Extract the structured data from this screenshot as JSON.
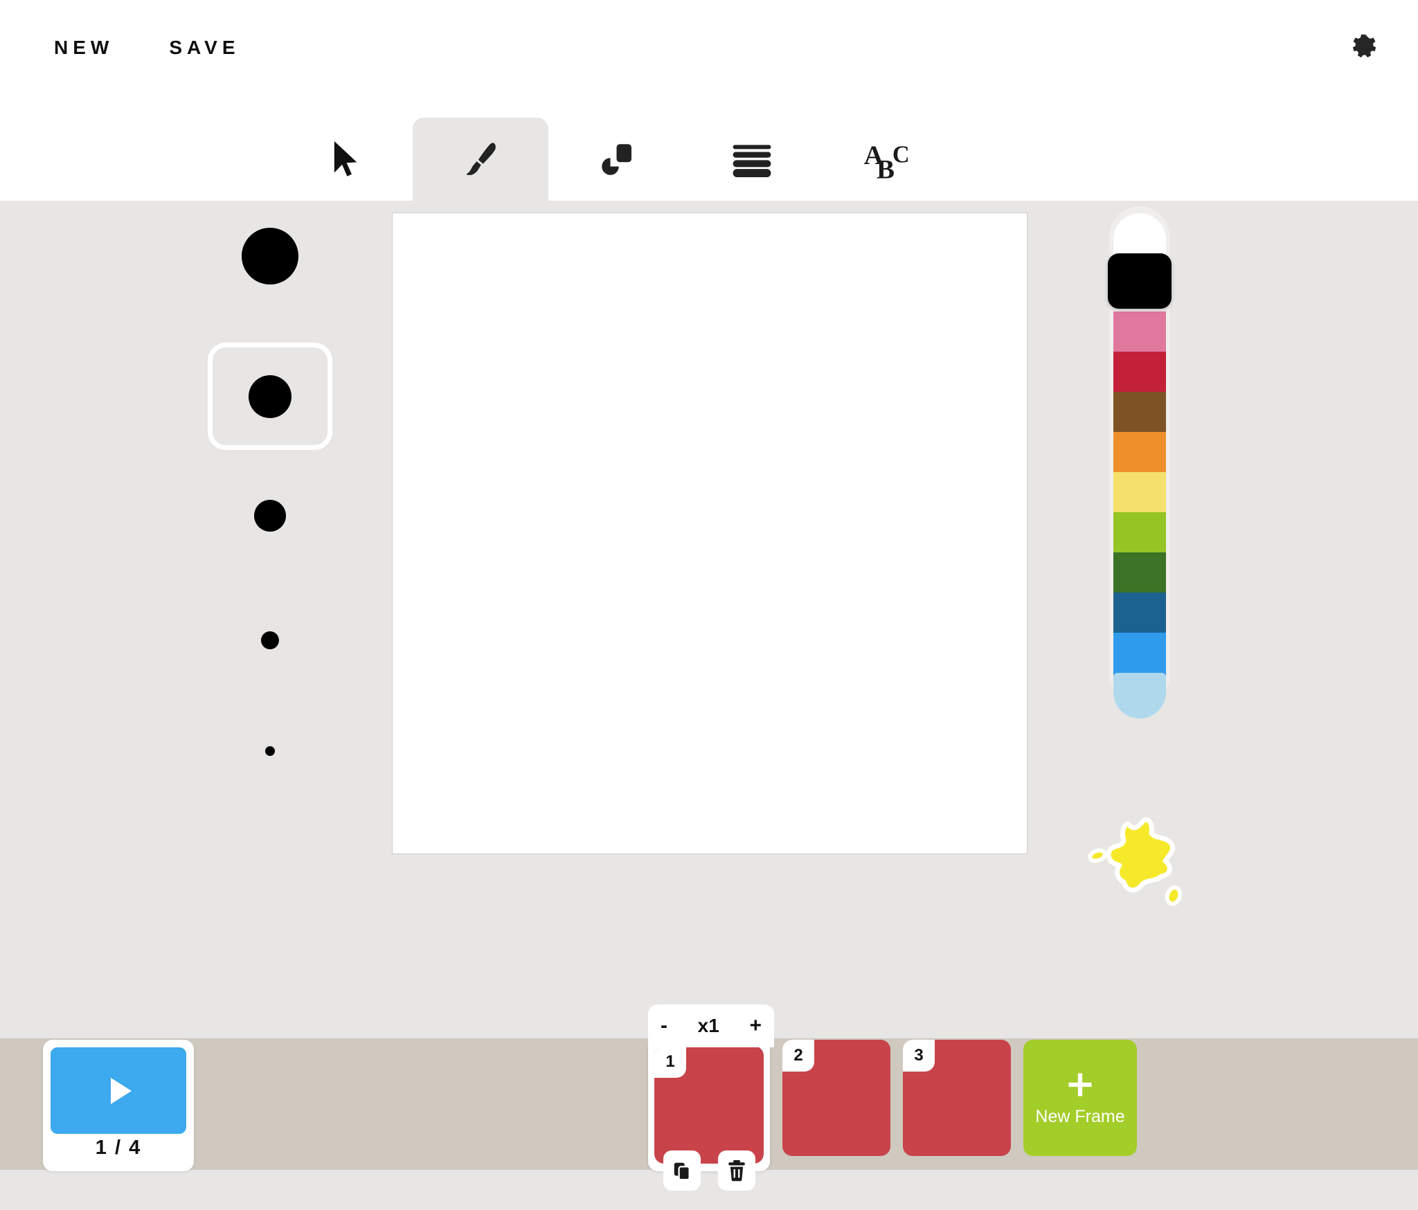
{
  "app": {
    "background_color": "#E7E6E4",
    "canvas_color": "#FFFFFF"
  },
  "topbar": {
    "new_label": "NEW",
    "save_label": "SAVE",
    "settings_icon": "gear-icon"
  },
  "toolbar": {
    "active_tool": "brush",
    "tabs": [
      {
        "id": "select",
        "icon": "cursor-arrow-icon",
        "active": false
      },
      {
        "id": "brush",
        "icon": "paintbrush-icon",
        "active": true
      },
      {
        "id": "shapes",
        "icon": "shapes-icon",
        "active": false
      },
      {
        "id": "lines",
        "icon": "stroke-weight-icon",
        "active": false
      },
      {
        "id": "text",
        "icon": "abc-text-icon",
        "active": false,
        "letters": [
          "A",
          "B",
          "C"
        ]
      }
    ]
  },
  "brush_sizes": {
    "selected_index": 1,
    "items": [
      {
        "diameter": 82
      },
      {
        "diameter": 62
      },
      {
        "diameter": 46
      },
      {
        "diameter": 26
      },
      {
        "diameter": 14
      }
    ]
  },
  "palette": {
    "selected_index": 1,
    "track_color": "#EFEEEC",
    "swatches": [
      {
        "name": "white",
        "color": "#FFFFFF"
      },
      {
        "name": "black",
        "color": "#000000"
      },
      {
        "name": "pink",
        "color": "#E0789E"
      },
      {
        "name": "crimson",
        "color": "#C4203A"
      },
      {
        "name": "brown",
        "color": "#7D5326"
      },
      {
        "name": "orange",
        "color": "#EE8F2C"
      },
      {
        "name": "yellow",
        "color": "#F5E06B"
      },
      {
        "name": "lime",
        "color": "#94C524"
      },
      {
        "name": "green",
        "color": "#3C7326"
      },
      {
        "name": "navy",
        "color": "#1B628F"
      },
      {
        "name": "blue",
        "color": "#2E9BED"
      },
      {
        "name": "pale-blue",
        "color": "#AFD8EC"
      }
    ]
  },
  "splat": {
    "icon": "paint-splat-icon",
    "color": "#F5E92A",
    "outline": "#FFFFFF"
  },
  "timeline": {
    "band_color": "#CFC9C0",
    "play": {
      "icon": "play-icon",
      "color": "#3DA9EE",
      "counter": "1 / 4"
    },
    "speed": {
      "minus_label": "-",
      "value_label": "x1",
      "plus_label": "+"
    },
    "frames": [
      {
        "number": "1",
        "color": "#C9434A",
        "selected": true
      },
      {
        "number": "2",
        "color": "#C9434A",
        "selected": false
      },
      {
        "number": "3",
        "color": "#C9434A",
        "selected": false
      }
    ],
    "frame_actions": [
      {
        "id": "duplicate",
        "icon": "copy-icon"
      },
      {
        "id": "delete",
        "icon": "trash-icon"
      }
    ],
    "new_frame": {
      "label": "New Frame",
      "icon": "plus-icon",
      "color": "#A3CD28"
    }
  }
}
